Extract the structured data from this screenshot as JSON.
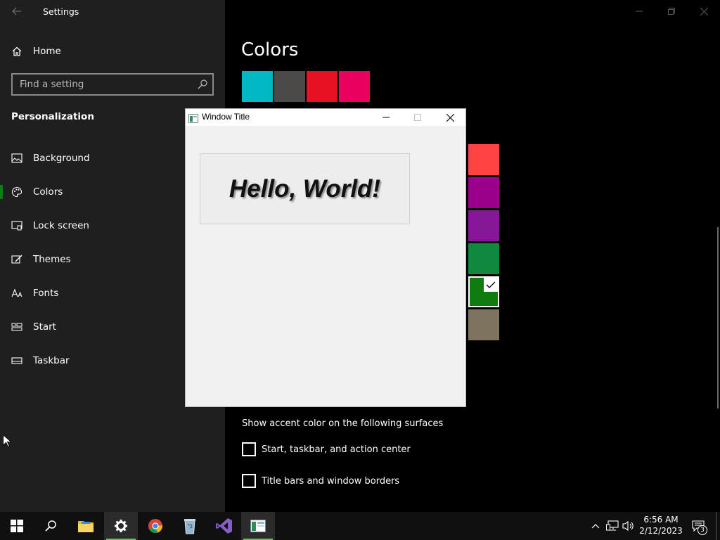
{
  "settings": {
    "app_title": "Settings",
    "home_label": "Home",
    "search_placeholder": "Find a setting",
    "section_title": "Personalization",
    "nav_items": [
      {
        "label": "Background",
        "icon": "picture-icon"
      },
      {
        "label": "Colors",
        "icon": "palette-icon",
        "active": true
      },
      {
        "label": "Lock screen",
        "icon": "lock-screen-icon"
      },
      {
        "label": "Themes",
        "icon": "themes-icon"
      },
      {
        "label": "Fonts",
        "icon": "fonts-icon"
      },
      {
        "label": "Start",
        "icon": "start-layout-icon"
      },
      {
        "label": "Taskbar",
        "icon": "taskbar-icon"
      }
    ]
  },
  "main": {
    "page_title": "Colors",
    "top_swatches": [
      "#00b7c3",
      "#4c4a48",
      "#e81123",
      "#ea005e"
    ],
    "side_swatches": [
      "#ff4343",
      "#9a0089",
      "#881798",
      "#10893e",
      "#107c10",
      "#7e735f"
    ],
    "selected_swatch": "#107c10",
    "accent_heading": "Show accent color on the following surfaces",
    "checkbox_start": "Start, taskbar, and action center",
    "checkbox_titlebars": "Title bars and window borders"
  },
  "app_window": {
    "title": "Window Title",
    "button_text": "Hello, World!"
  },
  "taskbar": {
    "apps": [
      "start-icon",
      "search-icon",
      "file-explorer-icon",
      "settings-gear-icon",
      "chrome-icon",
      "recycle-bin-icon",
      "visual-studio-icon",
      "app-window-icon"
    ],
    "time": "6:56 AM",
    "date": "2/12/2023",
    "notification_count": "3"
  },
  "colors": {
    "accent": "#107c10",
    "sidebar_bg": "#1f1f1f",
    "main_bg": "#000000",
    "taskbar_bg": "#101010"
  }
}
